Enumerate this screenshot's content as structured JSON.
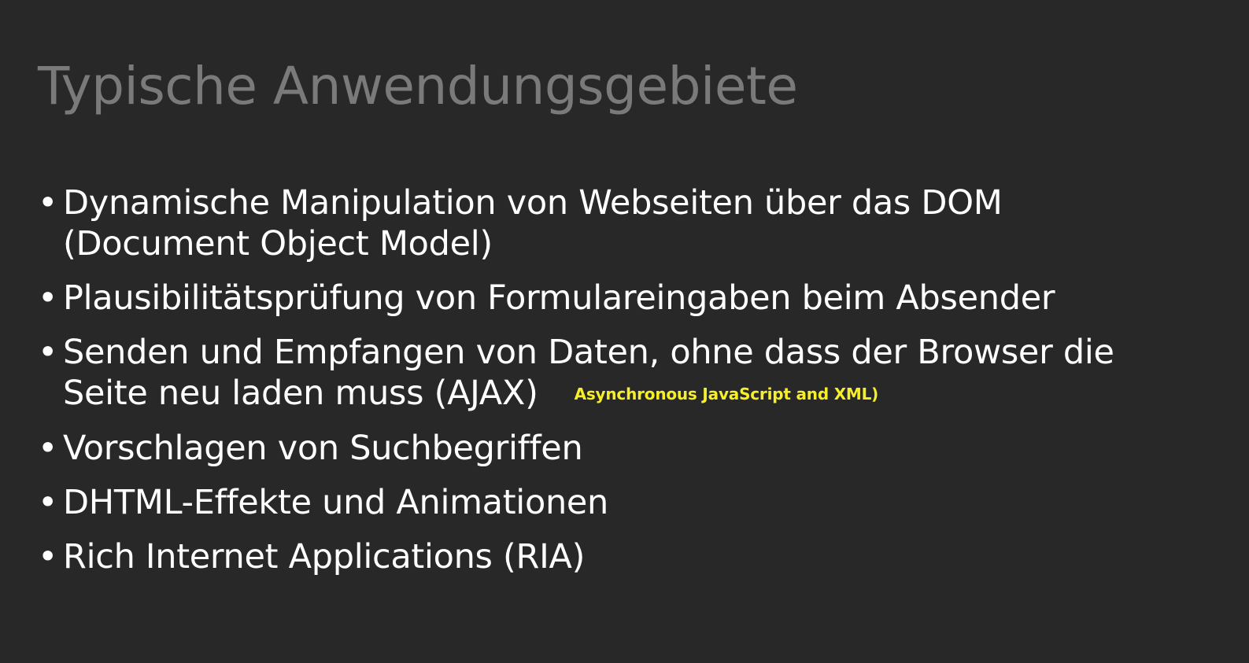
{
  "slide": {
    "title": "Typische Anwendungsgebiete",
    "bullets": [
      {
        "lines": [
          "Dynamische Manipulation von Webseiten über das DOM",
          "(Document Object Model)"
        ]
      },
      {
        "lines": [
          "Plausibilitätsprüfung von Formulareingaben beim Absender"
        ]
      },
      {
        "lines": [
          "Senden und Empfangen von Daten, ohne dass der Browser die",
          "Seite neu laden muss (AJAX)"
        ],
        "note": "Asynchronous JavaScript and XML)"
      },
      {
        "lines": [
          "Vorschlagen von Suchbegriffen"
        ]
      },
      {
        "lines": [
          "DHTML-Effekte und Animationen"
        ]
      },
      {
        "lines": [
          "Rich Internet Applications (RIA)"
        ]
      }
    ],
    "bullet_glyph": "•",
    "colors": {
      "background": "#282828",
      "title": "#7a7a7a",
      "text": "#ffffff",
      "note": "#f6ee2b"
    }
  }
}
